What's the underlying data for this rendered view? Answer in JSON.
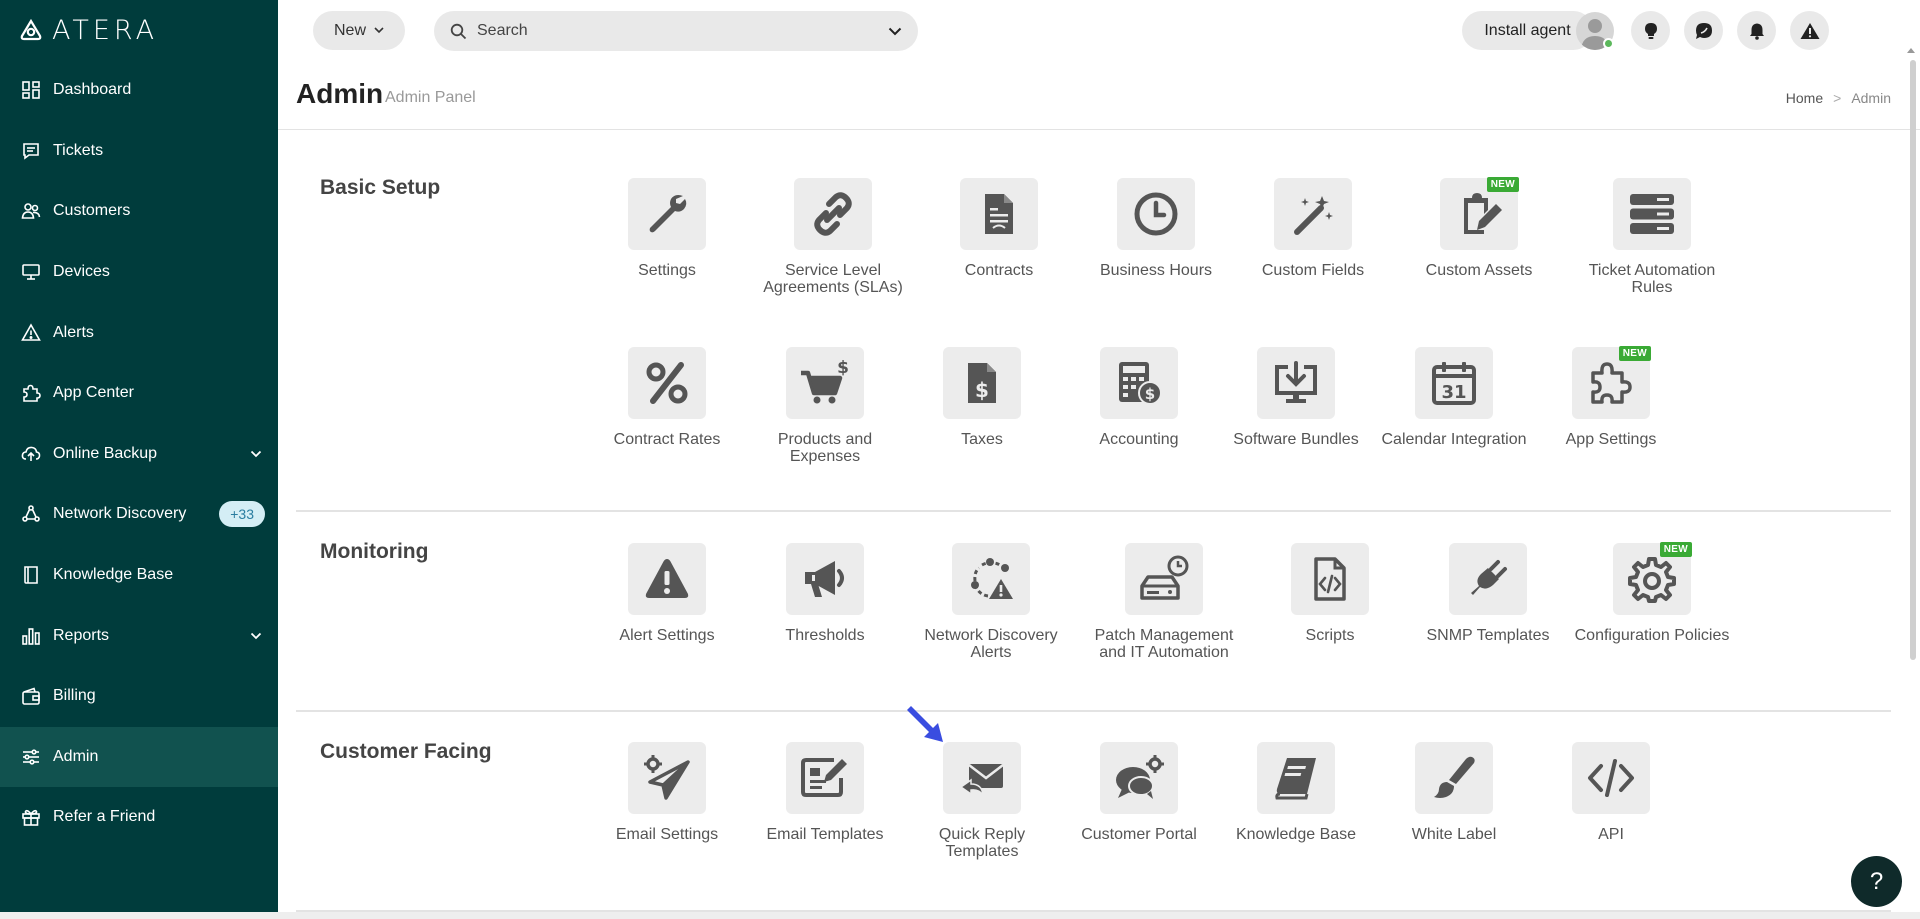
{
  "app": {
    "logo_text": "ATERA"
  },
  "sidebar": {
    "items": [
      {
        "label": "Dashboard",
        "icon": "dashboard-icon"
      },
      {
        "label": "Tickets",
        "icon": "ticket-icon"
      },
      {
        "label": "Customers",
        "icon": "users-icon"
      },
      {
        "label": "Devices",
        "icon": "monitor-icon"
      },
      {
        "label": "Alerts",
        "icon": "alert-triangle-icon"
      },
      {
        "label": "App Center",
        "icon": "puzzle-icon"
      },
      {
        "label": "Online Backup",
        "icon": "cloud-upload-icon"
      },
      {
        "label": "Network Discovery",
        "icon": "network-icon",
        "badge": "+33"
      },
      {
        "label": "Knowledge Base",
        "icon": "book-icon"
      },
      {
        "label": "Reports",
        "icon": "bar-chart-icon"
      },
      {
        "label": "Billing",
        "icon": "wallet-icon"
      },
      {
        "label": "Admin",
        "icon": "sliders-icon"
      },
      {
        "label": "Refer a Friend",
        "icon": "gift-icon"
      }
    ]
  },
  "header": {
    "new_label": "New",
    "search_placeholder": "Search",
    "install_label": "Install agent"
  },
  "page": {
    "title": "Admin",
    "subtitle": "Admin Panel",
    "breadcrumb_home": "Home",
    "breadcrumb_sep": ">",
    "breadcrumb_current": "Admin"
  },
  "sections": {
    "basic": {
      "title": "Basic Setup",
      "tiles": [
        {
          "label": "Settings",
          "icon": "wrench-icon"
        },
        {
          "label": "Service Level Agreements (SLAs)",
          "icon": "link-icon"
        },
        {
          "label": "Contracts",
          "icon": "contract-document-icon"
        },
        {
          "label": "Business Hours",
          "icon": "clock-icon"
        },
        {
          "label": "Custom Fields",
          "icon": "magic-wand-icon"
        },
        {
          "label": "Custom Assets",
          "icon": "clipboard-edit-icon",
          "badge": "NEW"
        },
        {
          "label": "Ticket Automation Rules",
          "icon": "server-stack-icon"
        },
        {
          "label": "Contract Rates",
          "icon": "percent-icon"
        },
        {
          "label": "Products and Expenses",
          "icon": "cart-dollar-icon"
        },
        {
          "label": "Taxes",
          "icon": "dollar-document-icon"
        },
        {
          "label": "Accounting",
          "icon": "calculator-icon"
        },
        {
          "label": "Software Bundles",
          "icon": "download-monitor-icon"
        },
        {
          "label": "Calendar Integration",
          "icon": "calendar-icon",
          "calendar_day": "31"
        },
        {
          "label": "App Settings",
          "icon": "puzzle-icon",
          "badge": "NEW"
        }
      ]
    },
    "monitoring": {
      "title": "Monitoring",
      "tiles": [
        {
          "label": "Alert Settings",
          "icon": "alert-triangle-icon"
        },
        {
          "label": "Thresholds",
          "icon": "megaphone-icon"
        },
        {
          "label": "Network Discovery Alerts",
          "icon": "network-alert-icon"
        },
        {
          "label": "Patch Management and IT Automation",
          "icon": "drive-clock-icon"
        },
        {
          "label": "Scripts",
          "icon": "code-document-icon"
        },
        {
          "label": "SNMP Templates",
          "icon": "plug-icon"
        },
        {
          "label": "Configuration Policies",
          "icon": "gear-icon",
          "badge": "NEW"
        }
      ]
    },
    "customer": {
      "title": "Customer Facing",
      "tiles": [
        {
          "label": "Email Settings",
          "icon": "paper-plane-gear-icon"
        },
        {
          "label": "Email Templates",
          "icon": "template-edit-icon"
        },
        {
          "label": "Quick Reply Templates",
          "icon": "envelope-reply-icon"
        },
        {
          "label": "Customer Portal",
          "icon": "chat-gear-icon"
        },
        {
          "label": "Knowledge Base",
          "icon": "book-icon"
        },
        {
          "label": "White Label",
          "icon": "brush-icon"
        },
        {
          "label": "API",
          "icon": "code-icon"
        }
      ]
    }
  },
  "help": {
    "label": "?"
  },
  "colors": {
    "sidebar_bg": "#003c3c",
    "sidebar_active": "#11524f",
    "new_badge": "#3aaa35",
    "icon_gray": "#555555",
    "tile_bg": "#ececec"
  }
}
